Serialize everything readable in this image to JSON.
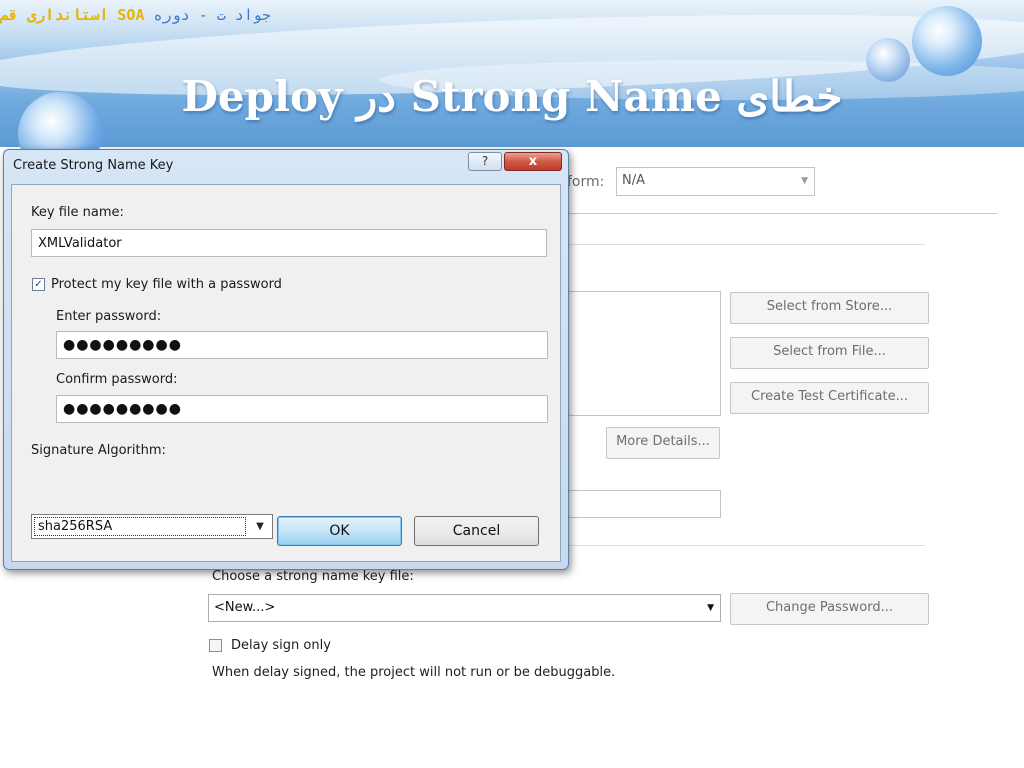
{
  "slide": {
    "subtitle_name": "جواد ت",
    "subtitle_dash": "-",
    "subtitle_course_before": "دوره",
    "subtitle_soa": "SOA",
    "subtitle_course_after": "استانداری قم",
    "title": "خطای Strong Name در Deploy"
  },
  "background_page": {
    "platform_label": "form:",
    "platform_value": "N/A",
    "buttons": {
      "select_from_store": "Select from Store...",
      "select_from_file": "Select from File...",
      "create_test_certificate": "Create Test Certificate...",
      "more_details": "More Details...",
      "change_password": "Change Password..."
    },
    "key_file_label": "Choose a strong name key file:",
    "key_file_value": "<New...>",
    "delay_sign_label": "Delay sign only",
    "delay_sign_note": "When delay signed, the project will not run or be debuggable."
  },
  "dialog": {
    "title": "Create Strong Name Key",
    "help_glyph": "?",
    "close_glyph": "x",
    "key_file_name_label": "Key file name:",
    "key_file_name_value": "XMLValidator",
    "protect_label": "Protect my key file with a password",
    "protect_checked": true,
    "enter_password_label": "Enter password:",
    "enter_password_value": "●●●●●●●●●",
    "confirm_password_label": "Confirm password:",
    "confirm_password_value": "●●●●●●●●●",
    "signature_label": "Signature Algorithm:",
    "signature_value": "sha256RSA",
    "ok_label": "OK",
    "cancel_label": "Cancel"
  }
}
